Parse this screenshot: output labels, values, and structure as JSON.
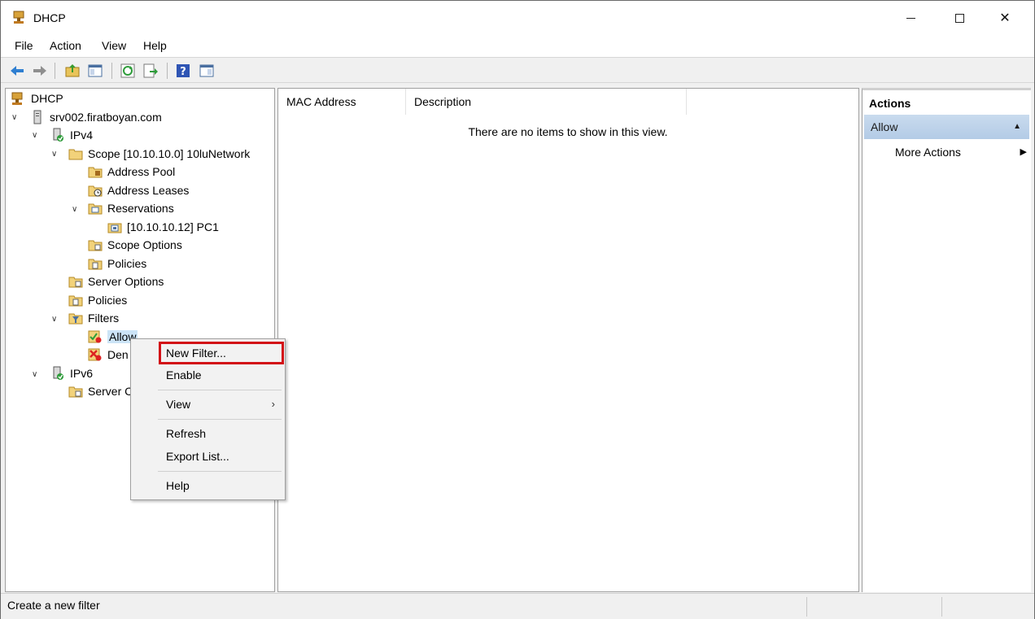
{
  "window": {
    "title": "DHCP",
    "controls": {
      "minimize": "minimize",
      "maximize": "maximize",
      "close": "✕"
    }
  },
  "menubar": {
    "items": [
      "File",
      "Action",
      "View",
      "Help"
    ]
  },
  "toolbar": {
    "buttons": [
      "back-icon",
      "forward-icon",
      "up-folder-icon",
      "show-hide-tree-icon",
      "refresh-icon",
      "export-list-icon",
      "help-icon",
      "show-hide-action-pane-icon"
    ]
  },
  "tree": {
    "items": [
      {
        "label": "DHCP"
      },
      {
        "label": "srv002.firatboyan.com"
      },
      {
        "label": "IPv4"
      },
      {
        "label": "Scope [10.10.10.0] 10luNetwork"
      },
      {
        "label": "Address Pool"
      },
      {
        "label": "Address Leases"
      },
      {
        "label": "Reservations"
      },
      {
        "label": "[10.10.10.12] PC1"
      },
      {
        "label": "Scope Options"
      },
      {
        "label": "Policies"
      },
      {
        "label": "Server Options"
      },
      {
        "label": "Policies"
      },
      {
        "label": "Filters"
      },
      {
        "label": "Allow"
      },
      {
        "label": "Den"
      },
      {
        "label": "IPv6"
      },
      {
        "label": "Server C"
      }
    ]
  },
  "list": {
    "columns": [
      "MAC Address",
      "Description"
    ],
    "empty_message": "There are no items to show in this view."
  },
  "actions": {
    "title": "Actions",
    "group": "Allow",
    "items": [
      "More Actions"
    ]
  },
  "context_menu": {
    "items": [
      "New Filter...",
      "Enable",
      "View",
      "Refresh",
      "Export List...",
      "Help"
    ],
    "highlighted": "New Filter..."
  },
  "statusbar": {
    "text": "Create a new filter"
  },
  "colors": {
    "highlight_box": "#d20f16",
    "actions_group": "#c9dbee"
  }
}
